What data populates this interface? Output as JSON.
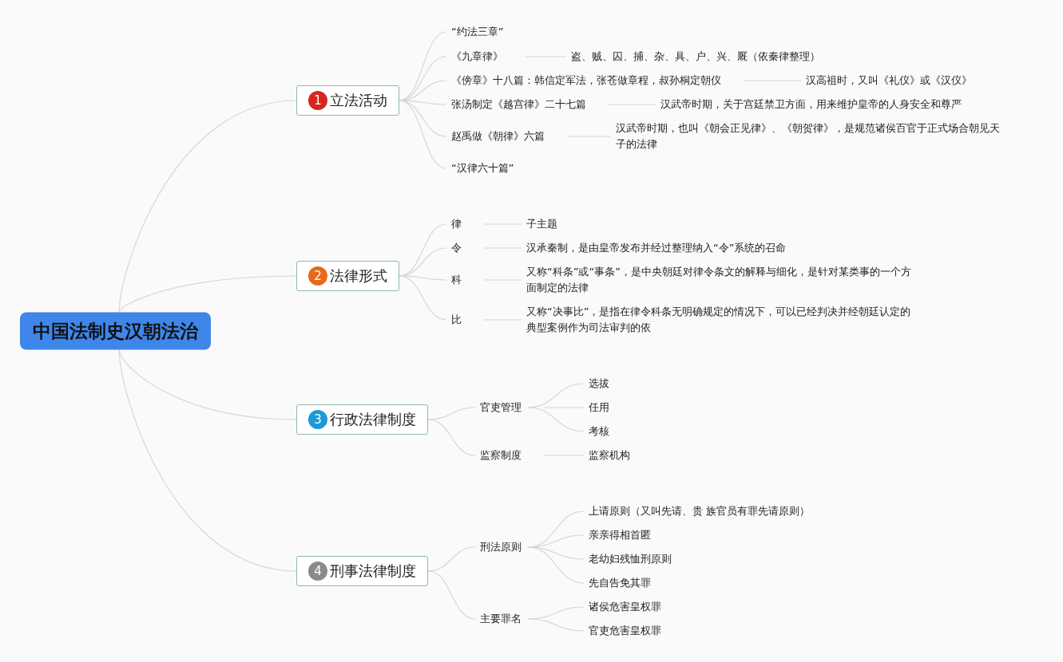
{
  "root": {
    "title": "中国法制史汉朝法治"
  },
  "branches": [
    {
      "number": "1",
      "color": "#d7261e",
      "title": "立法活动",
      "children": [
        {
          "label": "“约法三章”"
        },
        {
          "label": "《九章律》",
          "children": [
            {
              "label": "盗、贼、囚、捕、杂、具、户、兴、厩（依秦律整理）"
            }
          ]
        },
        {
          "label": "《傍章》十八篇：韩信定军法，张苍做章程，叔孙桐定朝仪",
          "children": [
            {
              "label": "汉高祖时，又叫《礼仪》或《汉仪》"
            }
          ]
        },
        {
          "label": "张汤制定《越宫律》二十七篇",
          "children": [
            {
              "label": "汉武帝时期，关于宫廷禁卫方面，用来维护皇帝的人身安全和尊严"
            }
          ]
        },
        {
          "label": "赵禹做《朝律》六篇",
          "children": [
            {
              "label": "汉武帝时期，也叫《朝会正见律》、《朝贺律》，是规范诸侯百官于正式场合朝见天子的法律"
            }
          ]
        },
        {
          "label": "“汉律六十篇”"
        }
      ]
    },
    {
      "number": "2",
      "color": "#e8691b",
      "title": "法律形式",
      "children": [
        {
          "label": "律",
          "children": [
            {
              "label": "子主题"
            }
          ]
        },
        {
          "label": "令",
          "children": [
            {
              "label": "汉承秦制，是由皇帝发布并经过整理纳入“令”系统的召命"
            }
          ]
        },
        {
          "label": "科",
          "children": [
            {
              "label": "又称“科条”或“事条”，是中央朝廷对律令条文的解释与细化，是针对某类事的一个方面制定的法律"
            }
          ]
        },
        {
          "label": "比",
          "children": [
            {
              "label": "又称“决事比”，是指在律令科条无明确规定的情况下，可以已经判决并经朝廷认定的典型案例作为司法审判的依"
            }
          ]
        }
      ]
    },
    {
      "number": "3",
      "color": "#1c9ad6",
      "title": "行政法律制度",
      "children": [
        {
          "label": "官吏管理",
          "children": [
            {
              "label": "选拔"
            },
            {
              "label": "任用"
            },
            {
              "label": "考核"
            }
          ]
        },
        {
          "label": "监察制度",
          "children": [
            {
              "label": "监察机构"
            }
          ]
        }
      ]
    },
    {
      "number": "4",
      "color": "#8a8a8a",
      "title": "刑事法律制度",
      "children": [
        {
          "label": "刑法原则",
          "children": [
            {
              "label": "上请原则（又叫先请、贵 族官员有罪先请原则）"
            },
            {
              "label": "亲亲得相首匿"
            },
            {
              "label": "老幼妇残恤刑原则"
            },
            {
              "label": "先自告免其罪"
            }
          ]
        },
        {
          "label": "主要罪名",
          "children": [
            {
              "label": "诸侯危害皇权罪"
            },
            {
              "label": "官吏危害皇权罪"
            }
          ]
        }
      ]
    }
  ]
}
